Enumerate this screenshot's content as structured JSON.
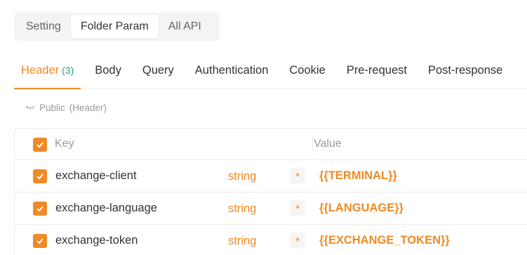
{
  "top_tabs": [
    {
      "label": "Setting"
    },
    {
      "label": "Folder Param"
    },
    {
      "label": "All API"
    }
  ],
  "tabs": {
    "header": {
      "label": "Header",
      "count": "(3)"
    },
    "body": "Body",
    "query": "Query",
    "authentication": "Authentication",
    "cookie": "Cookie",
    "pre_request": "Pre-request",
    "post_response": "Post-response"
  },
  "public_section": {
    "label": "Public",
    "qualifier": "(Header)",
    "icon": "eye-closed-icon"
  },
  "table": {
    "columns": {
      "key": "Key",
      "value": "Value"
    },
    "rows": [
      {
        "key": "exchange-client",
        "type": "string",
        "required": "*",
        "value": "{{TERMINAL}}",
        "checked": true
      },
      {
        "key": "exchange-language",
        "type": "string",
        "required": "*",
        "value": "{{LANGUAGE}}",
        "checked": true
      },
      {
        "key": "exchange-token",
        "type": "string",
        "required": "*",
        "value": "{{EXCHANGE_TOKEN}}",
        "checked": true
      }
    ]
  },
  "colors": {
    "accent": "#f08a24",
    "count": "#17a589",
    "muted_text": "#9a9a9a"
  }
}
